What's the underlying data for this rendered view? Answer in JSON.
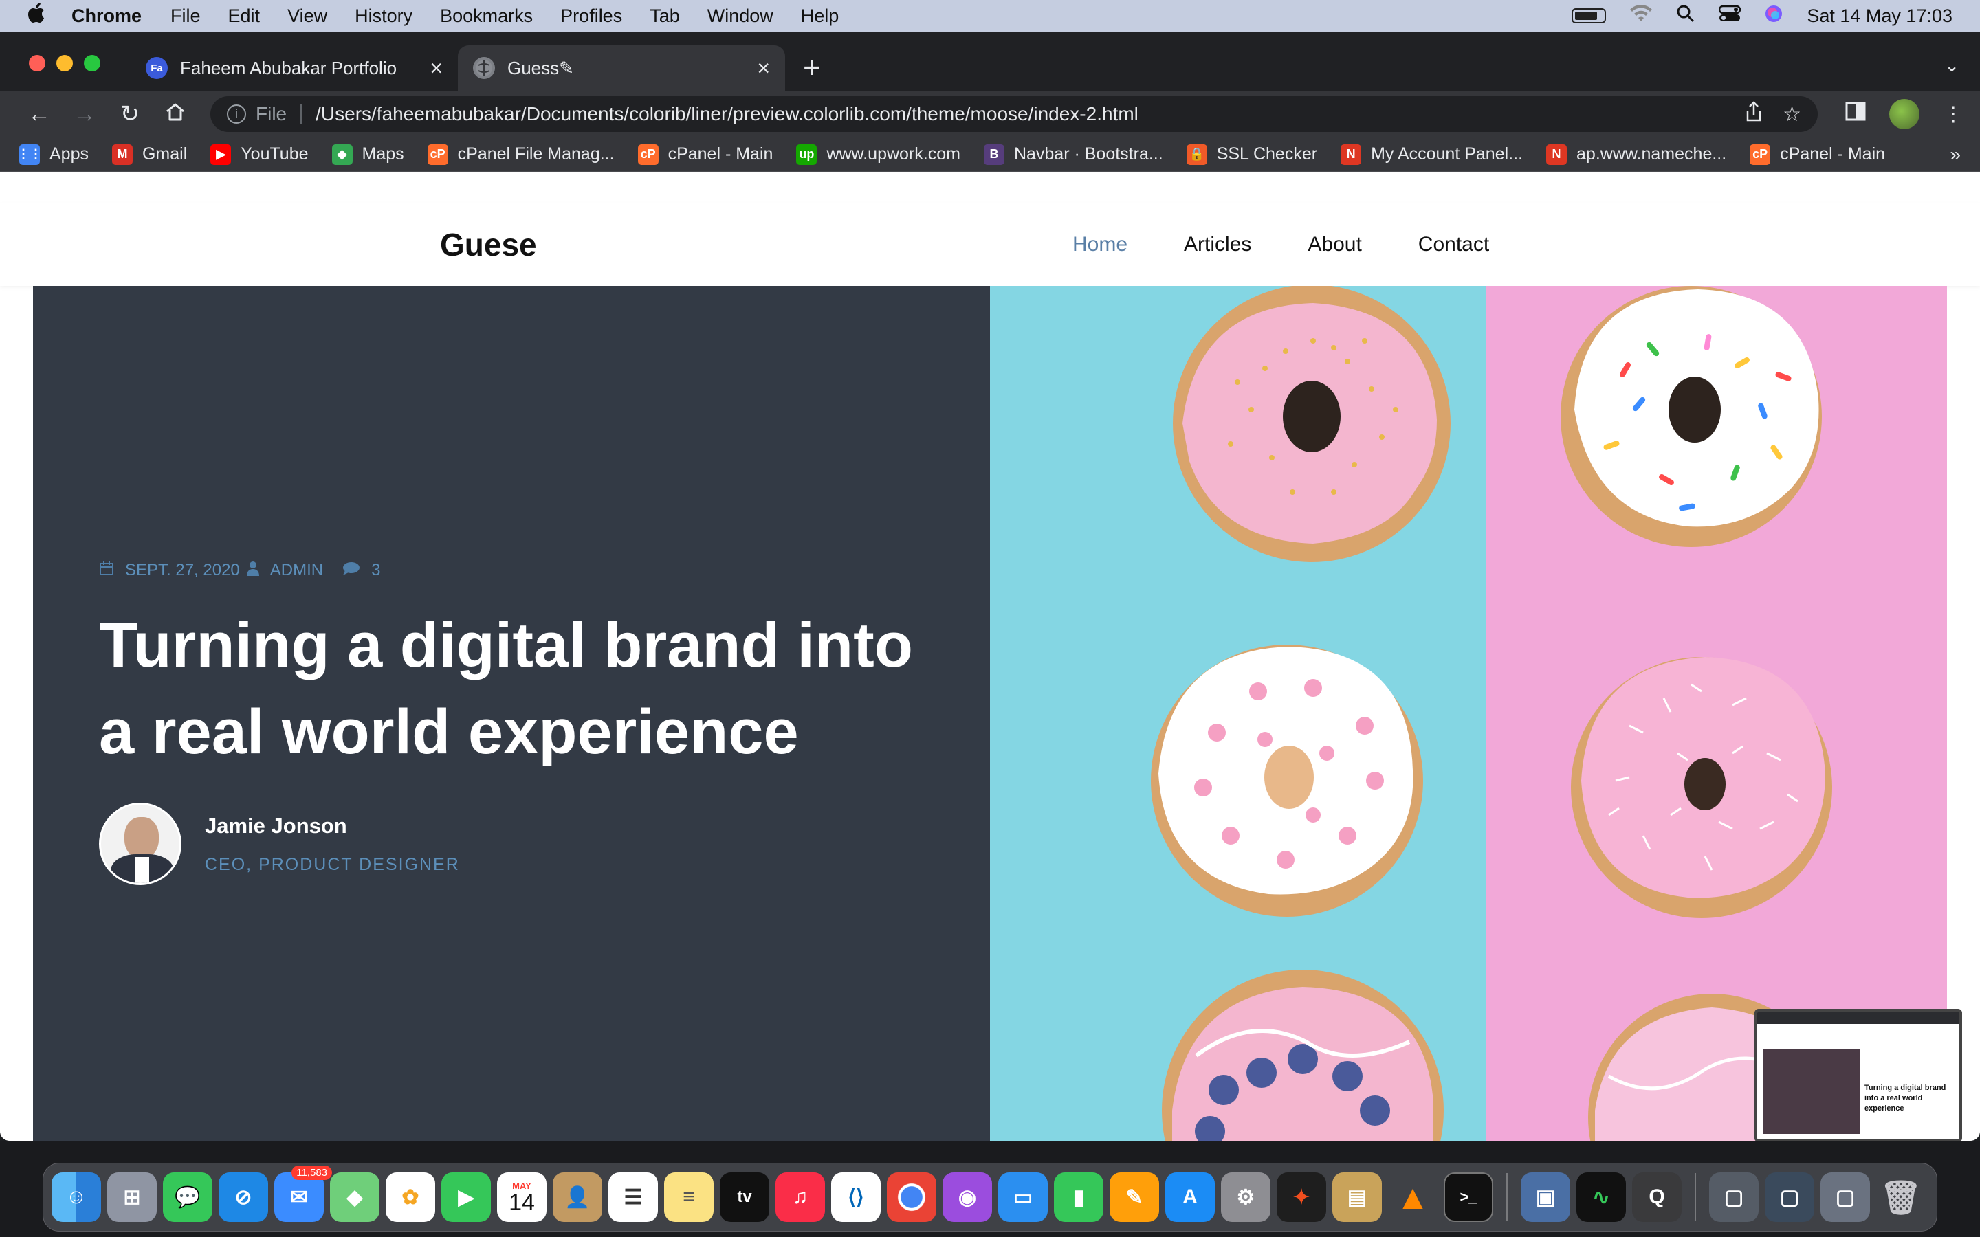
{
  "menubar": {
    "app_name": "Chrome",
    "items": [
      "File",
      "Edit",
      "View",
      "History",
      "Bookmarks",
      "Profiles",
      "Tab",
      "Window",
      "Help"
    ],
    "datetime": "Sat 14 May  17:03"
  },
  "browser": {
    "tabs": [
      {
        "title": "Faheem Abubakar Portfolio",
        "favicon": "Fa"
      },
      {
        "title": "Guess✎",
        "favicon": ""
      }
    ],
    "address": {
      "scheme": "File",
      "url": "/Users/faheemabubakar/Documents/colorib/liner/preview.colorlib.com/theme/moose/index-2.html"
    },
    "bookmarks": [
      {
        "label": "Apps",
        "icon": "apps-grid-icon",
        "color": "#4285f4",
        "glyph": "⋮⋮"
      },
      {
        "label": "Gmail",
        "icon": "gmail-icon",
        "color": "#d93025",
        "glyph": "M"
      },
      {
        "label": "YouTube",
        "icon": "youtube-icon",
        "color": "#ff0000",
        "glyph": "▶"
      },
      {
        "label": "Maps",
        "icon": "maps-icon",
        "color": "#34a853",
        "glyph": "◆"
      },
      {
        "label": "cPanel File Manag...",
        "icon": "cpanel-icon",
        "color": "#ff6c2c",
        "glyph": "cP"
      },
      {
        "label": "cPanel - Main",
        "icon": "cpanel-icon",
        "color": "#ff6c2c",
        "glyph": "cP"
      },
      {
        "label": "www.upwork.com",
        "icon": "upwork-icon",
        "color": "#14a800",
        "glyph": "up"
      },
      {
        "label": "Navbar · Bootstra...",
        "icon": "bootstrap-icon",
        "color": "#563d7c",
        "glyph": "B"
      },
      {
        "label": "SSL Checker",
        "icon": "ssl-lock-icon",
        "color": "#f05a28",
        "glyph": "🔒"
      },
      {
        "label": "My Account Panel...",
        "icon": "namecheap-icon",
        "color": "#de3723",
        "glyph": "N"
      },
      {
        "label": "ap.www.nameche...",
        "icon": "namecheap-icon",
        "color": "#de3723",
        "glyph": "N"
      },
      {
        "label": "cPanel - Main",
        "icon": "cpanel-icon",
        "color": "#ff6c2c",
        "glyph": "cP"
      }
    ]
  },
  "site": {
    "logo": "Guese",
    "nav": [
      "Home",
      "Articles",
      "About",
      "Contact"
    ],
    "active_nav": "Home",
    "post": {
      "date": "SEPT. 27, 2020",
      "author_tag": "ADMIN",
      "comments": "3",
      "title": "Turning a digital brand into a real world experience",
      "author_name": "Jamie Jonson",
      "author_role": "CEO, PRODUCT DESIGNER"
    }
  },
  "preview_thumbnail": {
    "caption": "Turning a digital brand into a real world experience"
  },
  "dock": {
    "mail_badge": "11,583",
    "calendar_month": "MAY",
    "calendar_day": "14",
    "tv_label": "tv"
  },
  "colors": {
    "hero_dark": "#333a45",
    "accent_blue": "#5c8fba",
    "nav_active": "#5a7fa6"
  }
}
